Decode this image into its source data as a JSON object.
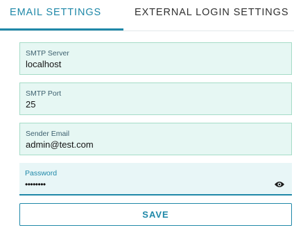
{
  "tabs": {
    "email_settings": "EMAIL SETTINGS",
    "external_login_settings": "EXTERNAL LOGIN SETTINGS",
    "active": "EMAIL SETTINGS"
  },
  "form": {
    "smtp_server": {
      "label": "SMTP Server",
      "value": "localhost"
    },
    "smtp_port": {
      "label": "SMTP Port",
      "value": "25"
    },
    "sender_email": {
      "label": "Sender Email",
      "value": "admin@test.com"
    },
    "password": {
      "label": "Password",
      "value": "••••••••",
      "toggle_icon": "eye-icon"
    },
    "save_label": "SAVE"
  },
  "colors": {
    "accent": "#1f88a8",
    "field_background": "#e6f7f3",
    "field_border": "#a5dcc7"
  }
}
